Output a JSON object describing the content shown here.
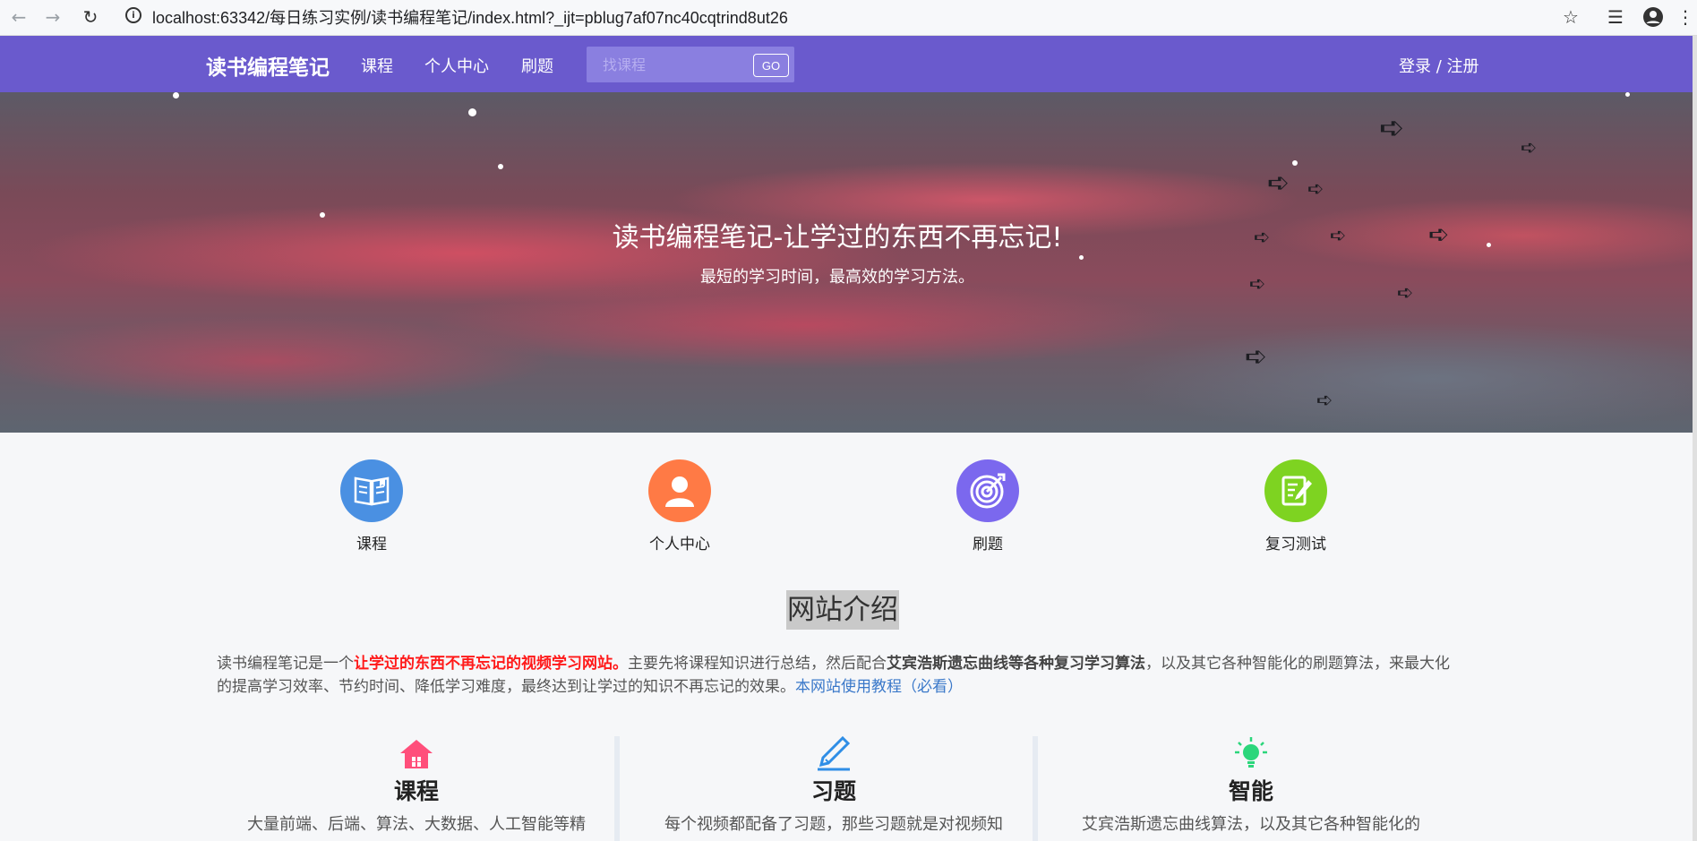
{
  "browser": {
    "url": "localhost:63342/每日练习实例/读书编程笔记/index.html?_ijt=pblug7af07nc40cqtrind8ut26"
  },
  "navbar": {
    "brand": "读书编程笔记",
    "links": [
      "课程",
      "个人中心",
      "刷题"
    ],
    "search_placeholder": "找课程",
    "search_button": "GO",
    "login": "登录 / 注册",
    "bg_color": "#6a5acd"
  },
  "hero": {
    "title": "读书编程笔记-让学过的东西不再忘记!",
    "subtitle": "最短的学习时间，最高效的学习方法。"
  },
  "features": [
    {
      "label": "课程",
      "icon": "book-icon",
      "color": "#4a90e2"
    },
    {
      "label": "个人中心",
      "icon": "user-icon",
      "color": "#ff7a45"
    },
    {
      "label": "刷题",
      "icon": "target-icon",
      "color": "#7b68ee"
    },
    {
      "label": "复习测试",
      "icon": "edit-icon",
      "color": "#7ed321"
    }
  ],
  "intro": {
    "title": "网站介绍",
    "text_1": "读书编程笔记是一个",
    "text_red": "让学过的东西不再忘记的视频学习网站。",
    "text_2": "主要先将课程知识进行总结，然后配合",
    "text_bold": "艾宾浩斯遗忘曲线等各种复习学习算法",
    "text_3": "，以及其它各种智能化的刷题算法，来最大化的提高学习效率、节约时间、降低学习难度，最终达到让学过的知识不再忘记的效果。",
    "link": "本网站使用教程（必看）"
  },
  "cards": [
    {
      "title": "课程",
      "desc": "大量前端、后端、算法、大数据、人工智能等精",
      "icon": "home-icon"
    },
    {
      "title": "习题",
      "desc": "每个视频都配备了习题，那些习题就是对视频知",
      "icon": "pen-icon"
    },
    {
      "title": "智能",
      "desc": "艾宾浩斯遗忘曲线算法，以及其它各种智能化的",
      "icon": "bulb-icon"
    }
  ]
}
